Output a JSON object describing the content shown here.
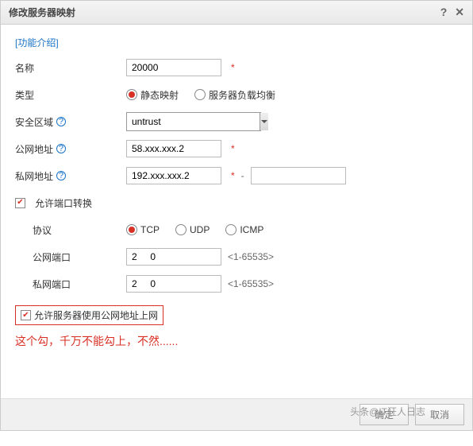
{
  "dialog": {
    "title": "修改服务器映射",
    "help_icon": "?",
    "close_icon": "✕"
  },
  "intro_link": "[功能介绍]",
  "fields": {
    "name": {
      "label": "名称",
      "value": "20000"
    },
    "type": {
      "label": "类型",
      "options": {
        "static": "静态映射",
        "lb": "服务器负载均衡"
      }
    },
    "security_zone": {
      "label": "安全区域",
      "value": "untrust"
    },
    "public_ip": {
      "label": "公网地址",
      "value": "58.xxx.xxx.2"
    },
    "private_ip": {
      "label": "私网地址",
      "value": "192.xxx.xxx.2",
      "end_value": ""
    },
    "allow_port_translate": {
      "label": "允许端口转换"
    },
    "protocol": {
      "label": "协议",
      "options": {
        "tcp": "TCP",
        "udp": "UDP",
        "icmp": "ICMP"
      }
    },
    "public_port": {
      "label": "公网端口",
      "value": "2     0",
      "hint": "<1-65535>"
    },
    "private_port": {
      "label": "私网端口",
      "value": "2     0",
      "hint": "<1-65535>"
    },
    "allow_public_access": {
      "label": "允许服务器使用公网地址上网"
    }
  },
  "warning": "这个勾，千万不能勾上，不然......",
  "footer": {
    "ok": "确定",
    "cancel": "取消"
  },
  "watermark": "头条@IT狂人日志",
  "dash": "-",
  "asterisk": "*"
}
